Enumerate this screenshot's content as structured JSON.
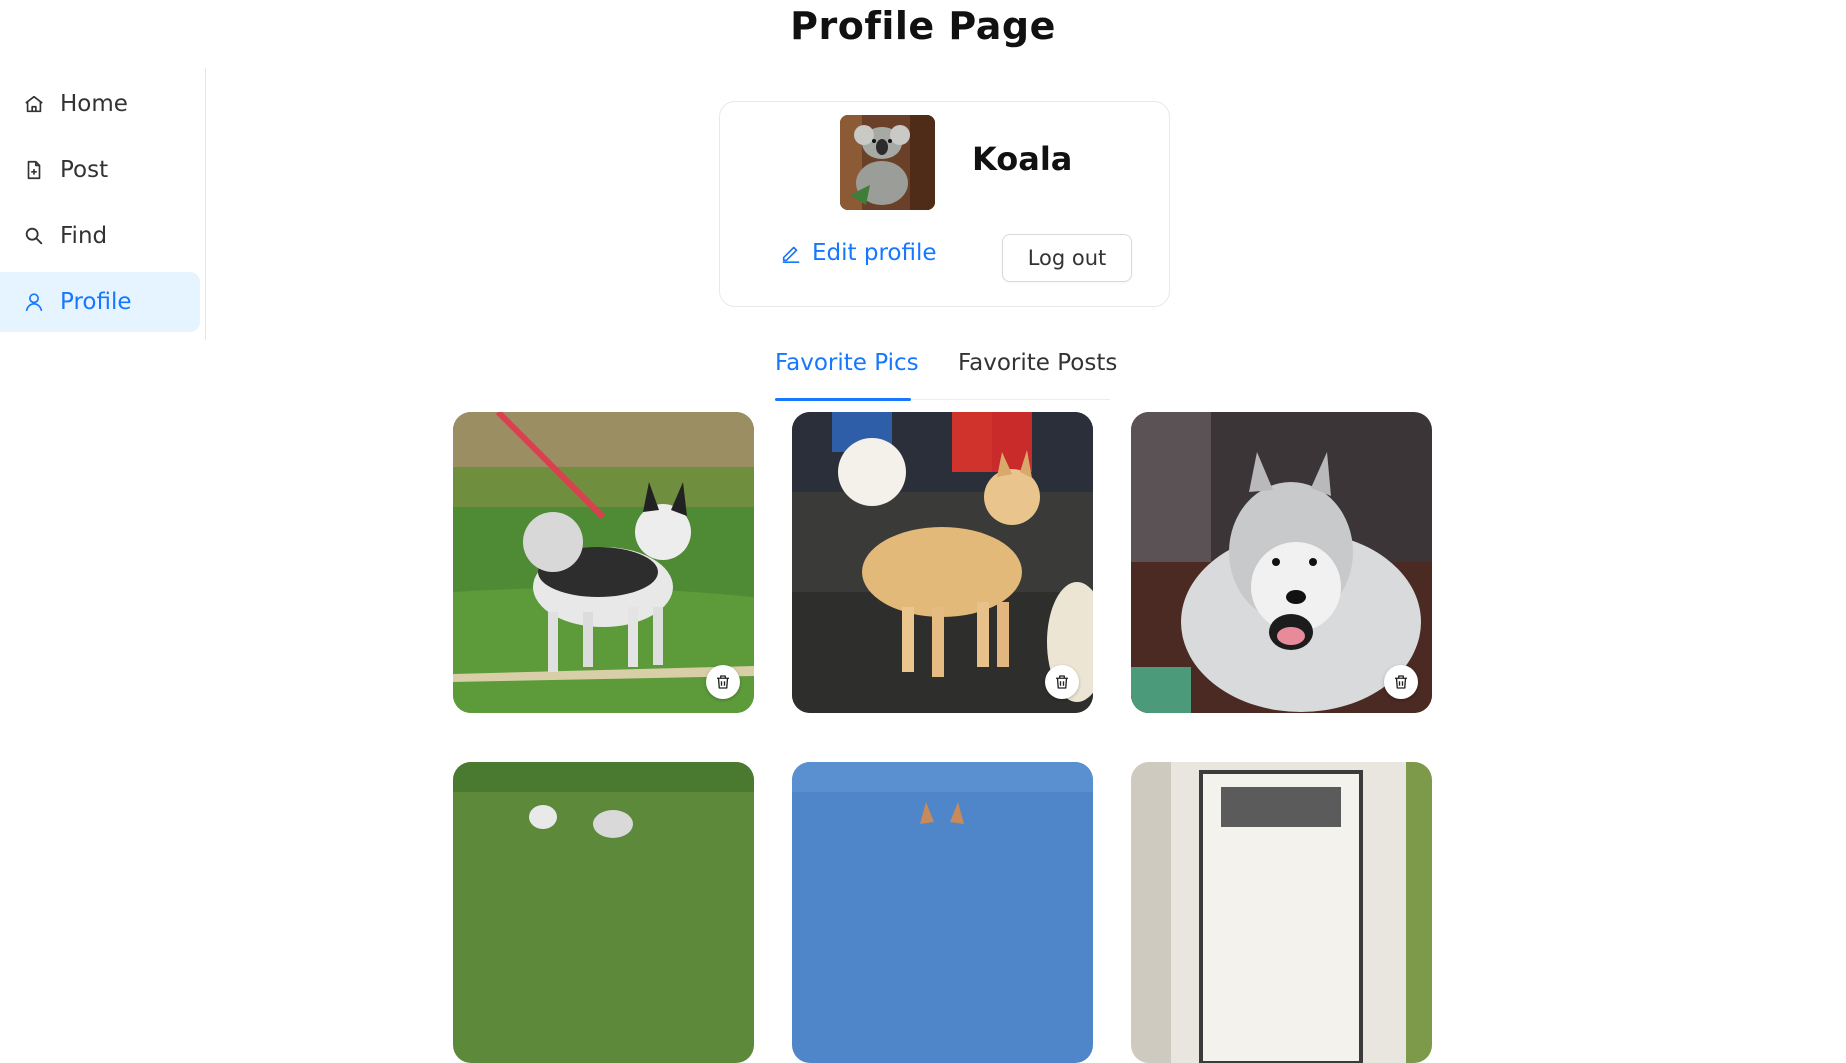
{
  "page": {
    "title": "Profile Page"
  },
  "sidebar": {
    "items": [
      {
        "label": "Home",
        "icon": "home-icon",
        "active": false
      },
      {
        "label": "Post",
        "icon": "file-add-icon",
        "active": false
      },
      {
        "label": "Find",
        "icon": "search-icon",
        "active": false
      },
      {
        "label": "Profile",
        "icon": "user-icon",
        "active": true
      }
    ]
  },
  "profile": {
    "username": "Koala",
    "avatar_alt": "koala-avatar",
    "edit_label": "Edit profile",
    "logout_label": "Log out"
  },
  "tabs": [
    {
      "label": "Favorite Pics",
      "active": true
    },
    {
      "label": "Favorite Posts",
      "active": false
    }
  ],
  "gallery": {
    "items": [
      {
        "subject": "husky on leash in grass"
      },
      {
        "subject": "fluffy tan dog"
      },
      {
        "subject": "white husky lying down"
      },
      {
        "subject": "dog in grass"
      },
      {
        "subject": "dog under blue sky"
      },
      {
        "subject": "dog at doorway"
      }
    ],
    "delete_icon": "trash-icon"
  },
  "colors": {
    "accent": "#1677ff",
    "active_bg": "#e6f4ff"
  }
}
